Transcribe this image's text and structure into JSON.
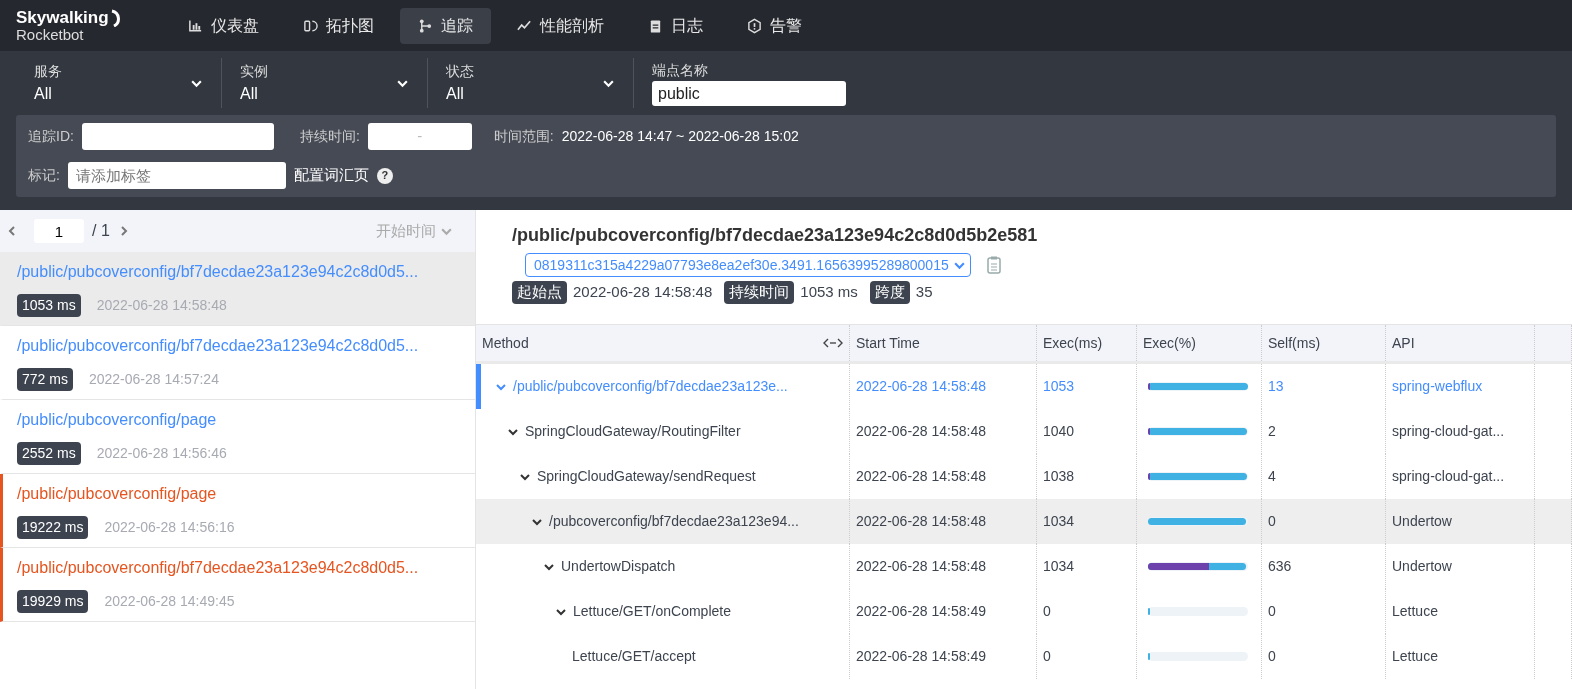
{
  "brand": {
    "name": "Skywalking",
    "subtitle": "Rocketbot"
  },
  "nav": [
    {
      "label": "仪表盘",
      "selected": false
    },
    {
      "label": "拓扑图",
      "selected": false
    },
    {
      "label": "追踪",
      "selected": true
    },
    {
      "label": "性能剖析",
      "selected": false
    },
    {
      "label": "日志",
      "selected": false
    },
    {
      "label": "告警",
      "selected": false
    }
  ],
  "filters": [
    {
      "label": "服务",
      "value": "All"
    },
    {
      "label": "实例",
      "value": "All"
    },
    {
      "label": "状态",
      "value": "All"
    }
  ],
  "endpoint": {
    "label": "端点名称",
    "value": "public"
  },
  "search": {
    "trace_id": {
      "label": "追踪ID:"
    },
    "duration": {
      "label": "持续时间:",
      "separator": "-"
    },
    "time_range": {
      "label": "时间范围:",
      "value": "2022-06-28 14:47 ~ 2022-06-28 15:02"
    },
    "tags": {
      "label": "标记:",
      "placeholder": "请添加标签"
    },
    "config_link": "配置词汇页",
    "help": "?"
  },
  "pager": {
    "page": "1",
    "total": "/ 1",
    "sort": "开始时间"
  },
  "traces": [
    {
      "name": "/public/pubcoverconfig/bf7decdae23a123e94c2c8d0d5...",
      "duration": "1053 ms",
      "time": "2022-06-28 14:58:48",
      "selected": true,
      "error": false
    },
    {
      "name": "/public/pubcoverconfig/bf7decdae23a123e94c2c8d0d5...",
      "duration": "772 ms",
      "time": "2022-06-28 14:57:24",
      "selected": false,
      "error": false
    },
    {
      "name": "/public/pubcoverconfig/page",
      "duration": "2552 ms",
      "time": "2022-06-28 14:56:46",
      "selected": false,
      "error": false
    },
    {
      "name": "/public/pubcoverconfig/page",
      "duration": "19222 ms",
      "time": "2022-06-28 14:56:16",
      "selected": false,
      "error": true
    },
    {
      "name": "/public/pubcoverconfig/bf7decdae23a123e94c2c8d0d5...",
      "duration": "19929 ms",
      "time": "2022-06-28 14:49:45",
      "selected": false,
      "error": true
    }
  ],
  "detail": {
    "title": "/public/pubcoverconfig/bf7decdae23a123e94c2c8d0d5b2e581",
    "trace_id": "0819311c315a4229a07793e8ea2ef30e.3491.16563995289800015",
    "meta": [
      {
        "label": "起始点",
        "value": "2022-06-28 14:58:48"
      },
      {
        "label": "持续时间",
        "value": "1053 ms"
      },
      {
        "label": "跨度",
        "value": "35"
      }
    ]
  },
  "table": {
    "columns": [
      "Method",
      "Start Time",
      "Exec(ms)",
      "Exec(%)",
      "Self(ms)",
      "API"
    ],
    "rows": [
      {
        "method": "/public/pubcoverconfig/bf7decdae23a123e...",
        "start": "2022-06-28 14:58:48",
        "exec": "1053",
        "level": 1,
        "self_bar": {
          "level": 0.02
        },
        "self": "13",
        "api": "spring-webflux",
        "selected": true,
        "hovered": false,
        "expanded": true,
        "children": [
          {
            "method": "SpringCloudGateway/RoutingFilter",
            "start": "2022-06-28 14:58:48",
            "exec": "1040",
            "level": 0.99,
            "self_bar": {
              "level": 0.02
            },
            "self": "2",
            "api": "spring-cloud-gat...",
            "selected": false,
            "hovered": false,
            "expanded": true,
            "children": [
              {
                "method": "SpringCloudGateway/sendRequest",
                "start": "2022-06-28 14:58:48",
                "exec": "1038",
                "level": 0.99,
                "self_bar": {
                  "level": 0.02
                },
                "self": "4",
                "api": "spring-cloud-gat...",
                "selected": false,
                "hovered": false,
                "expanded": true,
                "children": [
                  {
                    "method": "/pubcoverconfig/bf7decdae23a123e94...",
                    "start": "2022-06-28 14:58:48",
                    "exec": "1034",
                    "level": 0.98,
                    "self": "0",
                    "api": "Undertow",
                    "selected": false,
                    "hovered": true,
                    "expanded": true,
                    "children": [
                      {
                        "method": "UndertowDispatch",
                        "start": "2022-06-28 14:58:48",
                        "exec": "1034",
                        "level": 0.98,
                        "self_bar": {
                          "level": 0.61
                        },
                        "self": "636",
                        "api": "Undertow",
                        "selected": false,
                        "hovered": false,
                        "expanded": true,
                        "children": [
                          {
                            "method": "Lettuce/GET/onComplete",
                            "start": "2022-06-28 14:58:49",
                            "exec": "0",
                            "level": 0.02,
                            "self": "0",
                            "api": "Lettuce",
                            "selected": false,
                            "hovered": false,
                            "expanded": true,
                            "children": [
                              {
                                "method": "Lettuce/GET/accept",
                                "start": "2022-06-28 14:58:49",
                                "exec": "0",
                                "level": 0.02,
                                "self": "0",
                                "api": "Lettuce",
                                "selected": false,
                                "hovered": false
                              }
                            ]
                          }
                        ]
                      }
                    ]
                  }
                ]
              }
            ]
          }
        ]
      }
    ]
  }
}
